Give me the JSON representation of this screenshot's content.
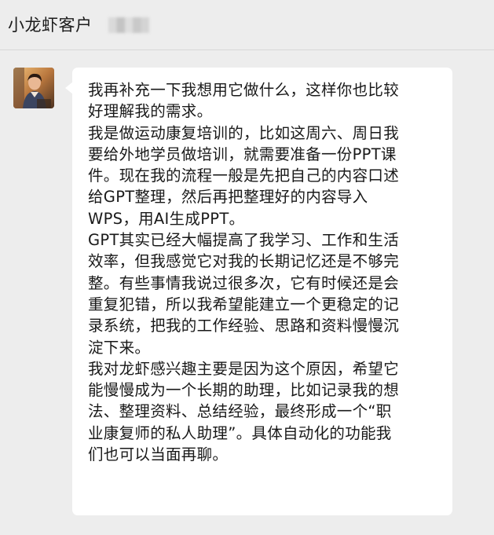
{
  "header": {
    "title": "小龙虾客户"
  },
  "message": {
    "lines": [
      "我再补充一下我想用它做什么，这样你也比较",
      "好理解我的需求。",
      "我是做运动康复培训的，比如这周六、周日我",
      "要给外地学员做培训，就需要准备一份PPT课",
      "件。现在我的流程一般是先把自己的内容口述",
      "给GPT整理，然后再把整理好的内容导入",
      "WPS，用AI生成PPT。",
      "GPT其实已经大幅提高了我学习、工作和生活",
      "效率，但我感觉它对我的长期记忆还是不够完",
      "整。有些事情我说过很多次，它有时候还是会",
      "重复犯错，所以我希望能建立一个更稳定的记",
      "录系统，把我的工作经验、思路和资料慢慢沉",
      "淀下来。",
      "我对龙虾感兴趣主要是因为这个原因，希望它",
      "能慢慢成为一个长期的助理，比如记录我的想",
      "法、整理资料、总结经验，最终形成一个“职",
      "业康复师的私人助理”。具体自动化的功能我",
      "们也可以当面再聊。"
    ]
  }
}
